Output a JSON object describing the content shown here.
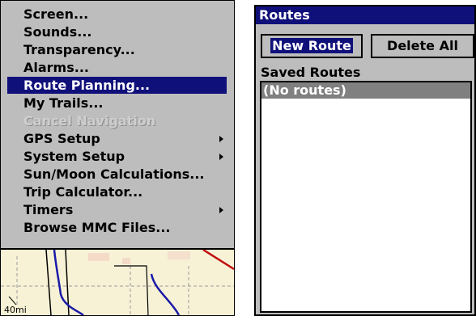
{
  "menu": {
    "items": [
      {
        "label": "Screen...",
        "submenu": false,
        "state": "normal"
      },
      {
        "label": "Sounds...",
        "submenu": false,
        "state": "normal"
      },
      {
        "label": "Transparency...",
        "submenu": false,
        "state": "normal"
      },
      {
        "label": "Alarms...",
        "submenu": false,
        "state": "normal"
      },
      {
        "label": "Route Planning...",
        "submenu": false,
        "state": "selected"
      },
      {
        "label": "My Trails...",
        "submenu": false,
        "state": "normal"
      },
      {
        "label": "Cancel Navigation",
        "submenu": false,
        "state": "disabled"
      },
      {
        "label": "GPS Setup",
        "submenu": true,
        "state": "normal"
      },
      {
        "label": "System Setup",
        "submenu": true,
        "state": "normal"
      },
      {
        "label": "Sun/Moon Calculations...",
        "submenu": false,
        "state": "normal"
      },
      {
        "label": "Trip Calculator...",
        "submenu": false,
        "state": "normal"
      },
      {
        "label": "Timers",
        "submenu": true,
        "state": "normal"
      },
      {
        "label": "Browse MMC Files...",
        "submenu": false,
        "state": "normal"
      }
    ]
  },
  "map": {
    "scale_label": "40mi"
  },
  "routes_dialog": {
    "title": "Routes",
    "new_route_label": "New Route",
    "delete_all_label": "Delete All",
    "saved_routes_label": "Saved Routes",
    "routes": [
      "(No routes)"
    ]
  },
  "colors": {
    "menu_background": "#bdbdbd",
    "selection": "#10107a",
    "map_background": "#f7f2d6",
    "list_selection": "#808080"
  }
}
